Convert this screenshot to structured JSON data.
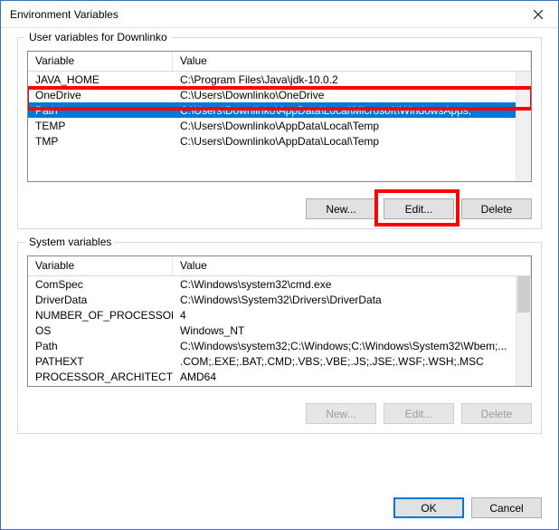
{
  "window": {
    "title": "Environment Variables"
  },
  "user_section": {
    "label": "User variables for Downlinko",
    "headers": {
      "variable": "Variable",
      "value": "Value"
    },
    "rows": [
      {
        "variable": "JAVA_HOME",
        "value": "C:\\Program Files\\Java\\jdk-10.0.2"
      },
      {
        "variable": "OneDrive",
        "value": "C:\\Users\\Downlinko\\OneDrive"
      },
      {
        "variable": "Path",
        "value": "C:\\Users\\Downlinko\\AppData\\Local\\Microsoft\\WindowsApps;",
        "selected": true
      },
      {
        "variable": "TEMP",
        "value": "C:\\Users\\Downlinko\\AppData\\Local\\Temp"
      },
      {
        "variable": "TMP",
        "value": "C:\\Users\\Downlinko\\AppData\\Local\\Temp"
      }
    ],
    "buttons": {
      "new": "New...",
      "edit": "Edit...",
      "delete": "Delete"
    }
  },
  "system_section": {
    "label": "System variables",
    "headers": {
      "variable": "Variable",
      "value": "Value"
    },
    "rows": [
      {
        "variable": "ComSpec",
        "value": "C:\\Windows\\system32\\cmd.exe"
      },
      {
        "variable": "DriverData",
        "value": "C:\\Windows\\System32\\Drivers\\DriverData"
      },
      {
        "variable": "NUMBER_OF_PROCESSORS",
        "value": "4"
      },
      {
        "variable": "OS",
        "value": "Windows_NT"
      },
      {
        "variable": "Path",
        "value": "C:\\Windows\\system32;C:\\Windows;C:\\Windows\\System32\\Wbem;..."
      },
      {
        "variable": "PATHEXT",
        "value": ".COM;.EXE;.BAT;.CMD;.VBS;.VBE;.JS;.JSE;.WSF;.WSH;.MSC"
      },
      {
        "variable": "PROCESSOR_ARCHITECTURE",
        "value": "AMD64"
      }
    ],
    "buttons": {
      "new": "New...",
      "edit": "Edit...",
      "delete": "Delete"
    }
  },
  "dialog_buttons": {
    "ok": "OK",
    "cancel": "Cancel"
  }
}
